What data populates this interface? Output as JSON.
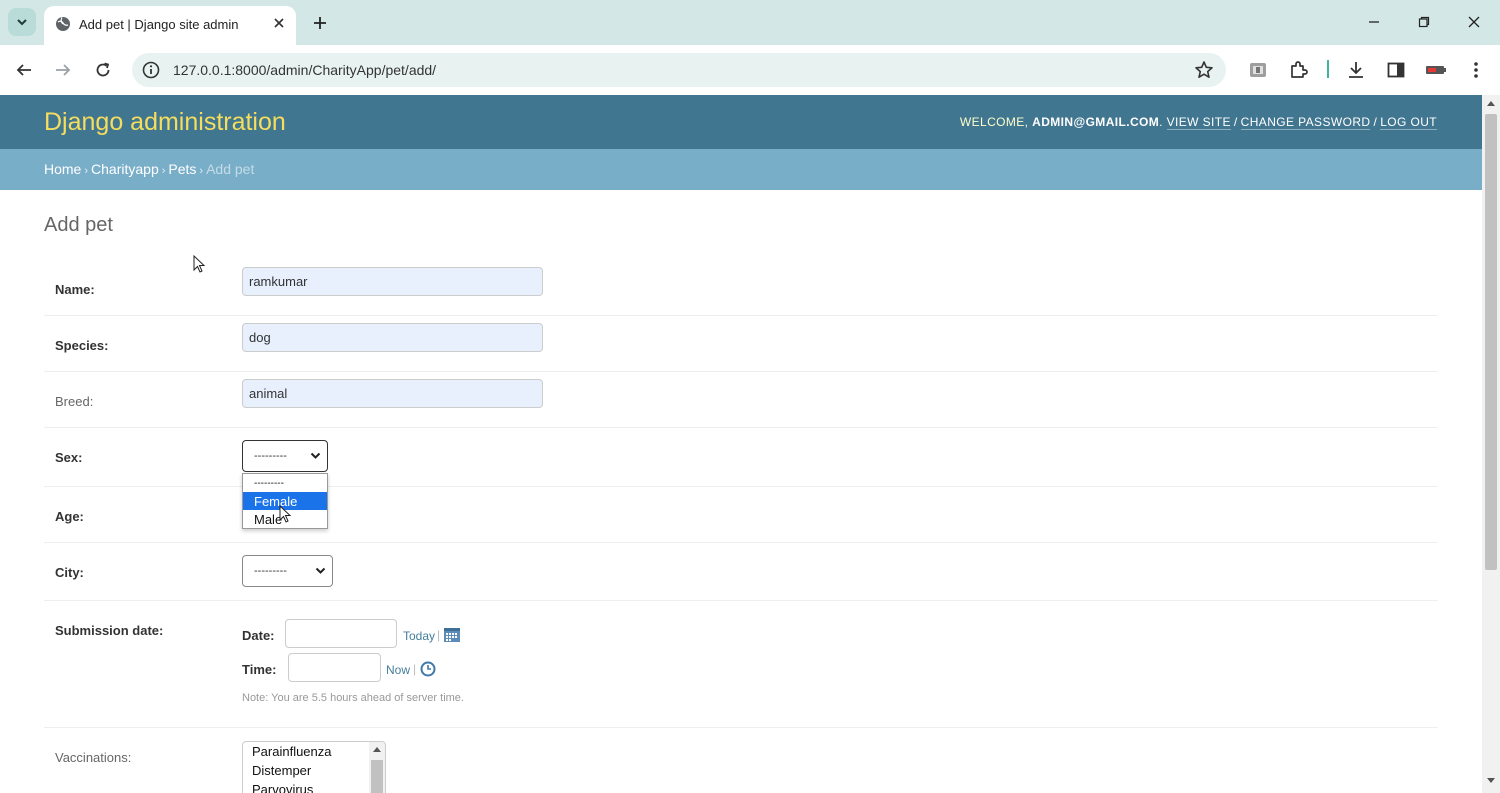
{
  "browser": {
    "tab_title": "Add pet | Django site admin",
    "url": "127.0.0.1:8000/admin/CharityApp/pet/add/"
  },
  "header": {
    "brand": "Django administration",
    "welcome": "WELCOME,",
    "user": "ADMIN@GMAIL.COM",
    "view_site": "VIEW SITE",
    "change_password": "CHANGE PASSWORD",
    "log_out": "LOG OUT"
  },
  "breadcrumbs": {
    "home": "Home",
    "app": "Charityapp",
    "model": "Pets",
    "current": "Add pet"
  },
  "page": {
    "title": "Add pet"
  },
  "form": {
    "name": {
      "label": "Name:",
      "value": "ramkumar"
    },
    "species": {
      "label": "Species:",
      "value": "dog"
    },
    "breed": {
      "label": "Breed:",
      "value": "animal"
    },
    "sex": {
      "label": "Sex:",
      "value": "---------",
      "options": [
        "---------",
        "Female",
        "Male"
      ],
      "highlighted": "Female"
    },
    "age": {
      "label": "Age:"
    },
    "city": {
      "label": "City:",
      "value": "---------"
    },
    "submission_date": {
      "label": "Submission date:",
      "date_label": "Date:",
      "time_label": "Time:",
      "today": "Today",
      "now": "Now",
      "pipe": "|",
      "note": "Note: You are 5.5 hours ahead of server time."
    },
    "vaccinations": {
      "label": "Vaccinations:",
      "options": [
        "Parainfluenza",
        "Distemper",
        "Parvovirus"
      ]
    }
  },
  "colors": {
    "header_bg": "#417690",
    "brand": "#f5dd5d",
    "breadcrumb_bg": "#79aec8",
    "link": "#447e9b",
    "highlight": "#1a73e8"
  }
}
